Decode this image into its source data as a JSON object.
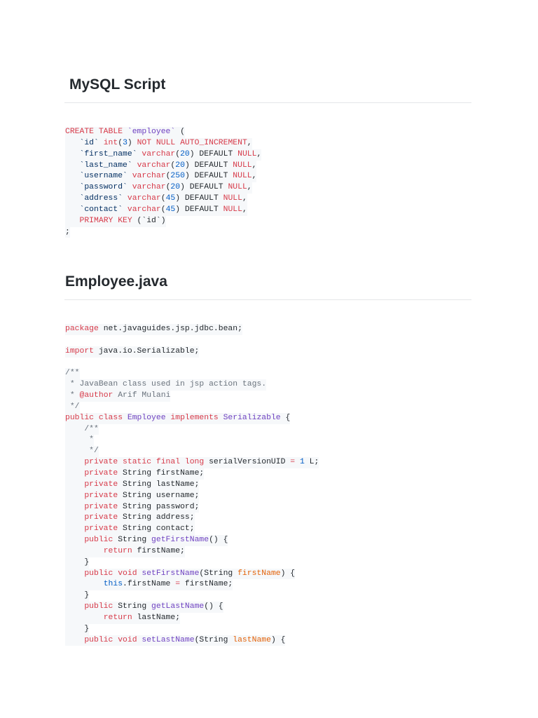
{
  "sql_section": {
    "title": "MySQL Script",
    "lines": [
      [
        [
          "k",
          "CREATE TABLE "
        ],
        [
          "t",
          "`employee`"
        ],
        [
          "p",
          " ("
        ]
      ],
      [
        [
          "p",
          "   "
        ],
        [
          "q",
          "`id`"
        ],
        [
          "p",
          " "
        ],
        [
          "k",
          "int"
        ],
        [
          "p",
          "("
        ],
        [
          "n",
          "3"
        ],
        [
          "p",
          ") "
        ],
        [
          "k",
          "NOT NULL AUTO_INCREMENT"
        ],
        [
          "p",
          ","
        ]
      ],
      [
        [
          "p",
          "   "
        ],
        [
          "q",
          "`first_name`"
        ],
        [
          "p",
          " "
        ],
        [
          "k",
          "varchar"
        ],
        [
          "p",
          "("
        ],
        [
          "n",
          "20"
        ],
        [
          "p",
          ") DEFAULT "
        ],
        [
          "k",
          "NULL"
        ],
        [
          "p",
          ","
        ]
      ],
      [
        [
          "p",
          "   "
        ],
        [
          "q",
          "`last_name`"
        ],
        [
          "p",
          " "
        ],
        [
          "k",
          "varchar"
        ],
        [
          "p",
          "("
        ],
        [
          "n",
          "20"
        ],
        [
          "p",
          ") DEFAULT "
        ],
        [
          "k",
          "NULL"
        ],
        [
          "p",
          ","
        ]
      ],
      [
        [
          "p",
          "   "
        ],
        [
          "q",
          "`username`"
        ],
        [
          "p",
          " "
        ],
        [
          "k",
          "varchar"
        ],
        [
          "p",
          "("
        ],
        [
          "n",
          "250"
        ],
        [
          "p",
          ") DEFAULT "
        ],
        [
          "k",
          "NULL"
        ],
        [
          "p",
          ","
        ]
      ],
      [
        [
          "p",
          "   "
        ],
        [
          "q",
          "`password`"
        ],
        [
          "p",
          " "
        ],
        [
          "k",
          "varchar"
        ],
        [
          "p",
          "("
        ],
        [
          "n",
          "20"
        ],
        [
          "p",
          ") DEFAULT "
        ],
        [
          "k",
          "NULL"
        ],
        [
          "p",
          ","
        ]
      ],
      [
        [
          "p",
          "   "
        ],
        [
          "q",
          "`address`"
        ],
        [
          "p",
          " "
        ],
        [
          "k",
          "varchar"
        ],
        [
          "p",
          "("
        ],
        [
          "n",
          "45"
        ],
        [
          "p",
          ") DEFAULT "
        ],
        [
          "k",
          "NULL"
        ],
        [
          "p",
          ","
        ]
      ],
      [
        [
          "p",
          "   "
        ],
        [
          "q",
          "`contact`"
        ],
        [
          "p",
          " "
        ],
        [
          "k",
          "varchar"
        ],
        [
          "p",
          "("
        ],
        [
          "n",
          "45"
        ],
        [
          "p",
          ") DEFAULT "
        ],
        [
          "k",
          "NULL"
        ],
        [
          "p",
          ","
        ]
      ],
      [
        [
          "p",
          "   "
        ],
        [
          "k",
          "PRIMARY KEY"
        ],
        [
          "p",
          " (`id`)"
        ]
      ],
      [
        [
          "p",
          ";"
        ]
      ]
    ]
  },
  "java_section": {
    "title": "Employee.java",
    "lines": [
      [
        [
          "k",
          "package"
        ],
        [
          "p",
          " net.javaguides.jsp.jdbc.bean;"
        ]
      ],
      [],
      [
        [
          "k",
          "import"
        ],
        [
          "p",
          " java.io.Serializable;"
        ]
      ],
      [],
      [
        [
          "c",
          "/**"
        ]
      ],
      [
        [
          "c",
          " * JavaBean class used in jsp action tags."
        ]
      ],
      [
        [
          "c",
          " * "
        ],
        [
          "k",
          "@author"
        ],
        [
          "c",
          " Arif Mulani"
        ]
      ],
      [
        [
          "c",
          " */"
        ]
      ],
      [
        [
          "k",
          "public class "
        ],
        [
          "t",
          "Employee"
        ],
        [
          "k",
          " implements "
        ],
        [
          "t",
          "Serializable"
        ],
        [
          "p",
          " {"
        ]
      ],
      [
        [
          "c",
          "    /**"
        ]
      ],
      [
        [
          "c",
          "     *"
        ]
      ],
      [
        [
          "c",
          "     */"
        ]
      ],
      [
        [
          "p",
          "    "
        ],
        [
          "k",
          "private static final long"
        ],
        [
          "p",
          " serialVersionUID "
        ],
        [
          "k",
          "="
        ],
        [
          "p",
          " "
        ],
        [
          "n",
          "1"
        ],
        [
          "p",
          " L;"
        ]
      ],
      [
        [
          "p",
          "    "
        ],
        [
          "k",
          "private"
        ],
        [
          "p",
          " String firstName;"
        ]
      ],
      [
        [
          "p",
          "    "
        ],
        [
          "k",
          "private"
        ],
        [
          "p",
          " String lastName;"
        ]
      ],
      [
        [
          "p",
          "    "
        ],
        [
          "k",
          "private"
        ],
        [
          "p",
          " String username;"
        ]
      ],
      [
        [
          "p",
          "    "
        ],
        [
          "k",
          "private"
        ],
        [
          "p",
          " String password;"
        ]
      ],
      [
        [
          "p",
          "    "
        ],
        [
          "k",
          "private"
        ],
        [
          "p",
          " String address;"
        ]
      ],
      [
        [
          "p",
          "    "
        ],
        [
          "k",
          "private"
        ],
        [
          "p",
          " String contact;"
        ]
      ],
      [
        [
          "p",
          "    "
        ],
        [
          "k",
          "public"
        ],
        [
          "p",
          " String "
        ],
        [
          "t",
          "getFirstName"
        ],
        [
          "p",
          "() {"
        ]
      ],
      [
        [
          "p",
          "        "
        ],
        [
          "k",
          "return"
        ],
        [
          "p",
          " firstName;"
        ]
      ],
      [
        [
          "p",
          "    }"
        ]
      ],
      [
        [
          "p",
          "    "
        ],
        [
          "k",
          "public void "
        ],
        [
          "t",
          "setFirstName"
        ],
        [
          "p",
          "(String "
        ],
        [
          "o",
          "firstName"
        ],
        [
          "p",
          ") {"
        ]
      ],
      [
        [
          "p",
          "        "
        ],
        [
          "n",
          "this"
        ],
        [
          "p",
          ".firstName "
        ],
        [
          "k",
          "="
        ],
        [
          "p",
          " firstName;"
        ]
      ],
      [
        [
          "p",
          "    }"
        ]
      ],
      [
        [
          "p",
          "    "
        ],
        [
          "k",
          "public"
        ],
        [
          "p",
          " String "
        ],
        [
          "t",
          "getLastName"
        ],
        [
          "p",
          "() {"
        ]
      ],
      [
        [
          "p",
          "        "
        ],
        [
          "k",
          "return"
        ],
        [
          "p",
          " lastName;"
        ]
      ],
      [
        [
          "p",
          "    }"
        ]
      ],
      [
        [
          "p",
          "    "
        ],
        [
          "k",
          "public void "
        ],
        [
          "t",
          "setLastName"
        ],
        [
          "p",
          "(String "
        ],
        [
          "o",
          "lastName"
        ],
        [
          "p",
          ") {"
        ]
      ]
    ]
  }
}
